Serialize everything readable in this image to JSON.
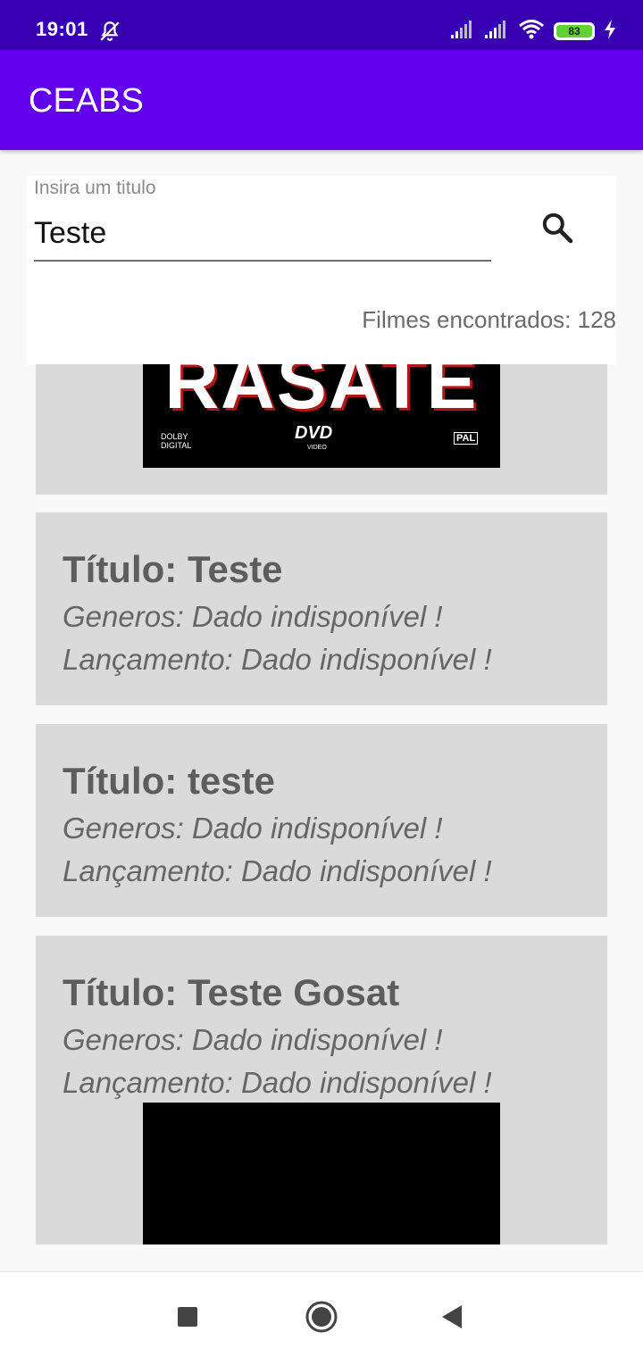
{
  "status_bar": {
    "time": "19:01",
    "battery": "83"
  },
  "app": {
    "title": "CEABS"
  },
  "search": {
    "label": "Insira um titulo",
    "value": "Teste",
    "count_text": "Filmes encontrados: 128"
  },
  "movies": [
    {
      "poster": {
        "title_text": "RASATE",
        "left_badge": "DOLBY DIGITAL",
        "center_badge": "DVD",
        "center_sub": "VIDEO",
        "right_badge": "PAL"
      }
    },
    {
      "title": "Título: Teste",
      "genres": "Generos: Dado indisponível !",
      "release": "Lançamento: Dado indisponível !"
    },
    {
      "title": "Título: teste",
      "genres": "Generos: Dado indisponível !",
      "release": "Lançamento: Dado indisponível !"
    },
    {
      "title": "Título: Teste Gosat",
      "genres": "Generos: Dado indisponível !",
      "release": "Lançamento: Dado indisponível !"
    }
  ],
  "colors": {
    "status_bar": "#3700b3",
    "app_bar": "#6200ee",
    "card": "#dadada"
  },
  "icons": [
    "do-not-disturb-icon",
    "signal-icon",
    "wifi-icon",
    "battery-icon",
    "charging-icon",
    "search-icon",
    "nav-recents-icon",
    "nav-home-icon",
    "nav-back-icon"
  ]
}
